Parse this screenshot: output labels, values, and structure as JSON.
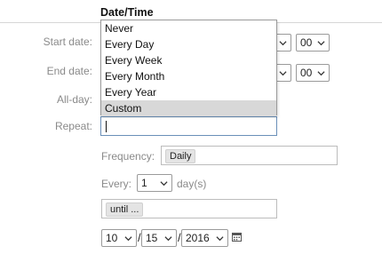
{
  "section": {
    "title": "Date/Time"
  },
  "labels": {
    "start": "Start date:",
    "end": "End date:",
    "allday": "All-day:",
    "repeat": "Repeat:",
    "frequency": "Frequency:",
    "every": "Every:",
    "every_unit": "day(s)"
  },
  "start": {
    "minute": "00"
  },
  "end": {
    "minute": "00"
  },
  "repeat_dropdown": {
    "options": [
      "Never",
      "Every Day",
      "Every Week",
      "Every Month",
      "Every Year",
      "Custom"
    ],
    "selected": "Custom"
  },
  "frequency": {
    "value": "Daily"
  },
  "every": {
    "value": "1"
  },
  "until": {
    "label": "until ..."
  },
  "until_date": {
    "month": "10",
    "day": "15",
    "year": "2016"
  },
  "icons": [
    "chevron-down-icon",
    "calendar-icon"
  ]
}
